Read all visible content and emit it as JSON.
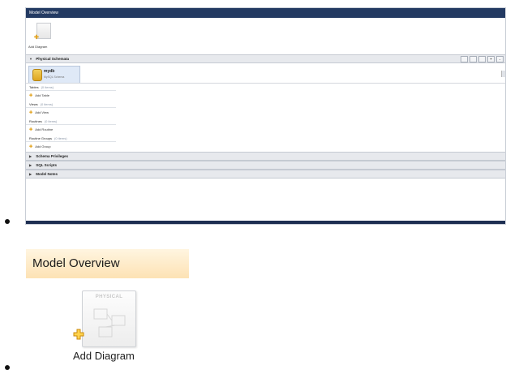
{
  "screenshot_1": {
    "window_title": "Model Overview",
    "add_diagram_label": "Add Diagram",
    "physical_schemata": {
      "label": "Physical Schemata",
      "toolbar_buttons": [
        "",
        "",
        "",
        "+",
        "-"
      ]
    },
    "schema": {
      "name": "mydb",
      "subtitle": "MySQL Schema"
    },
    "groups": [
      {
        "label": "Tables",
        "count": "(0 items)",
        "add_label": "Add Table"
      },
      {
        "label": "Views",
        "count": "(0 items)",
        "add_label": "Add View"
      },
      {
        "label": "Routines",
        "count": "(0 items)",
        "add_label": "Add Routine"
      },
      {
        "label": "Routine Groups",
        "count": "(0 items)",
        "add_label": "Add Group"
      }
    ],
    "collapsed_sections": [
      "Schema Privileges",
      "SQL Scripts",
      "Model Notes"
    ]
  },
  "screenshot_2": {
    "header_title": "Model Overview",
    "diagram_badge": "PHYSICAL",
    "add_diagram_label": "Add Diagram"
  },
  "colors": {
    "title_bar": "#233a62",
    "header_gradient_top": "#fff5e0",
    "header_gradient_bottom": "#fde2b4",
    "add_plus": "#e2a11a",
    "schema_icon": "#dea520"
  },
  "icons": [
    "diagram-icon",
    "plus-icon",
    "database-icon",
    "add-icon",
    "expand-arrow-icon",
    "collapse-arrow-icon"
  ]
}
